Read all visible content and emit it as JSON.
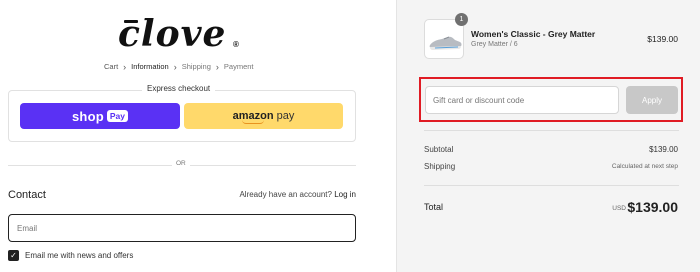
{
  "brand": {
    "name": "clove",
    "reg": "®"
  },
  "breadcrumb": {
    "items": [
      "Cart",
      "Information",
      "Shipping",
      "Payment"
    ]
  },
  "express_checkout": {
    "title": "Express checkout",
    "shoppay": {
      "shop": "shop",
      "pay": "Pay"
    },
    "amazonpay": {
      "amazon": "amazon",
      "pay": "pay"
    }
  },
  "divider": {
    "or": "OR"
  },
  "contact": {
    "title": "Contact",
    "account_prompt": "Already have an account?",
    "login": "Log in",
    "email_placeholder": "Email",
    "newsletter_label": "Email me with news and offers"
  },
  "order": {
    "quantity": "1",
    "product_name": "Women's Classic - Grey Matter",
    "variant": "Grey Matter / 6",
    "price": "$139.00"
  },
  "discount": {
    "placeholder": "Gift card or discount code",
    "apply_label": "Apply"
  },
  "summary": {
    "subtotal_label": "Subtotal",
    "subtotal_value": "$139.00",
    "shipping_label": "Shipping",
    "shipping_value": "Calculated at next step",
    "total_label": "Total",
    "currency": "USD",
    "total_value": "$139.00"
  },
  "colors": {
    "shoppay": "#5a31f4",
    "amazonpay": "#ffd96b",
    "highlight": "#e01b24"
  }
}
